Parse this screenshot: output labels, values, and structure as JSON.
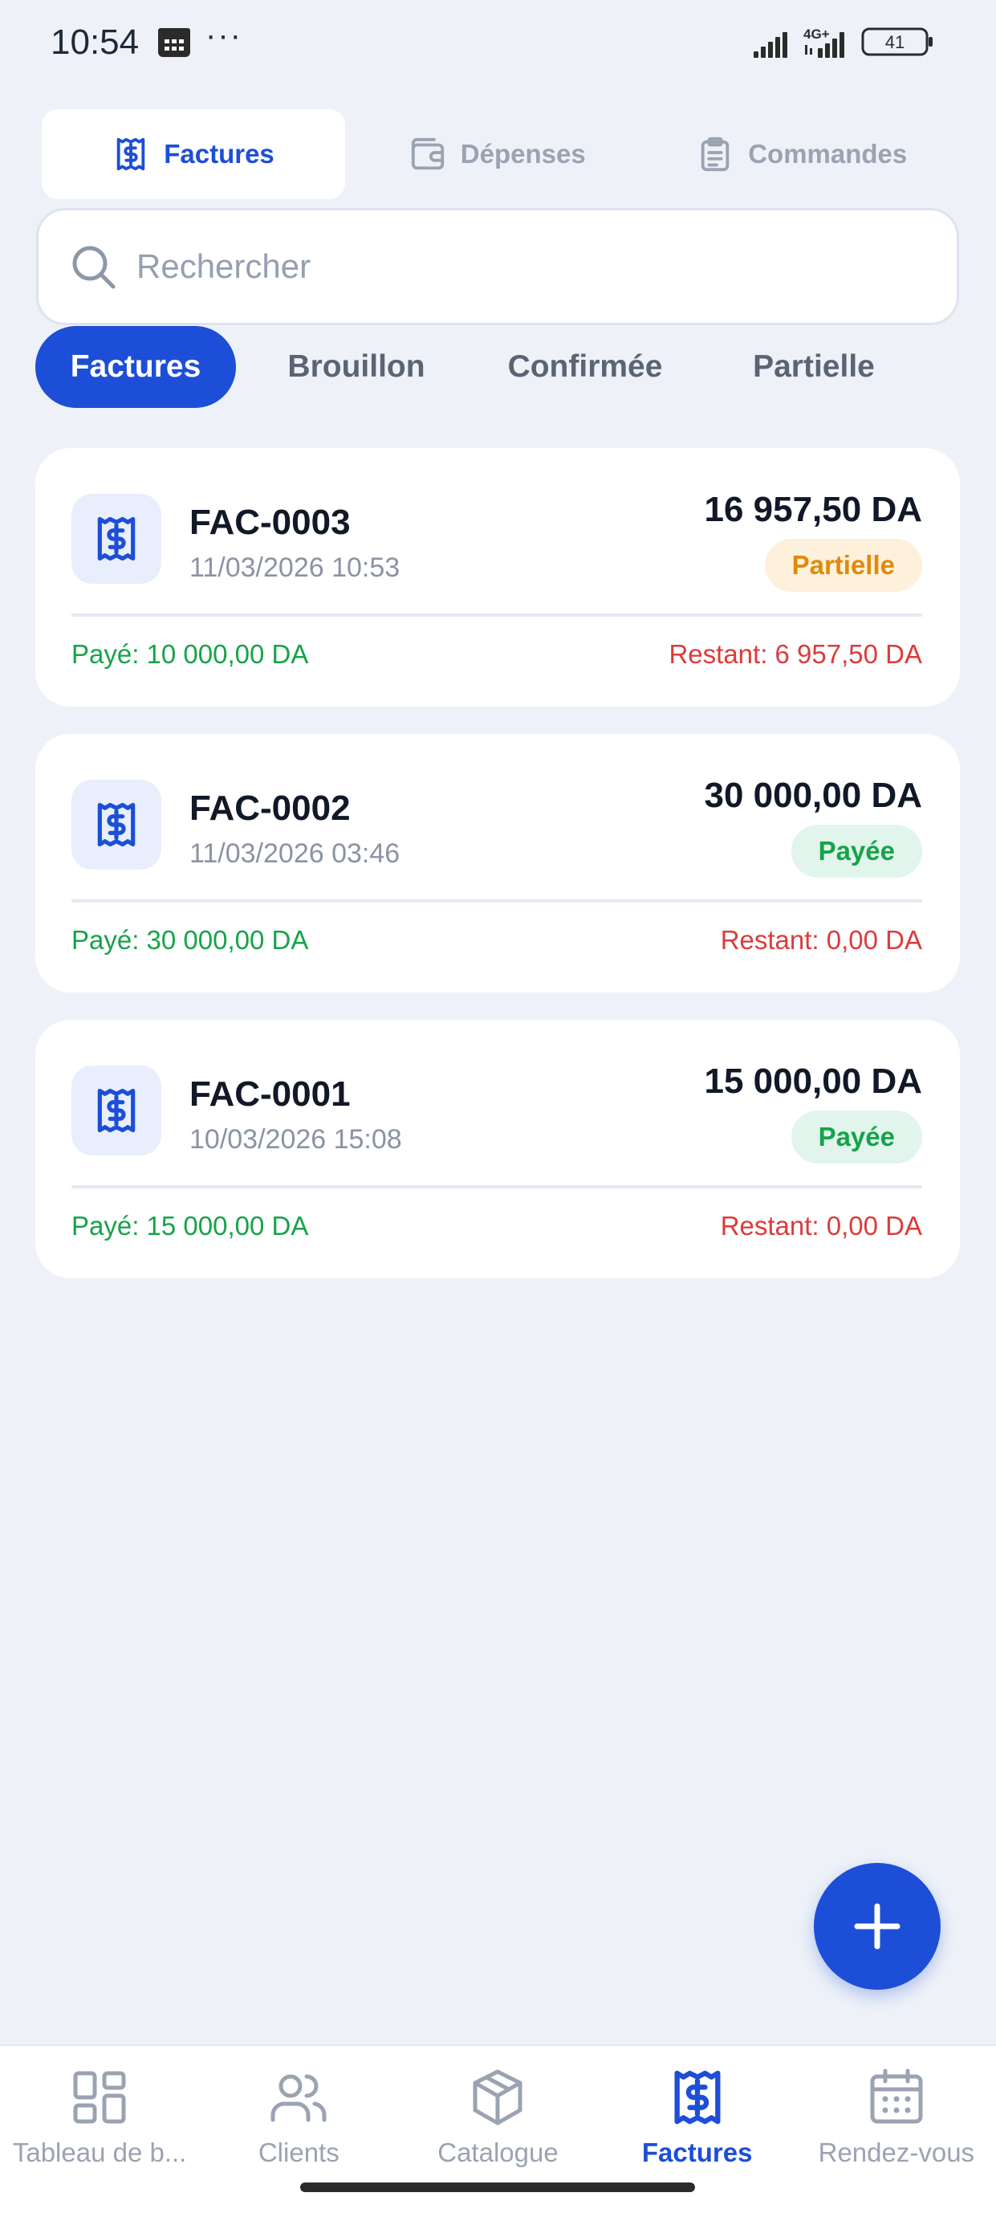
{
  "status": {
    "time": "10:54",
    "dots": "···",
    "network": "4G+",
    "battery": "41"
  },
  "top_tabs": [
    {
      "label": "Factures",
      "icon": "receipt-icon",
      "active": true
    },
    {
      "label": "Dépenses",
      "icon": "wallet-icon",
      "active": false
    },
    {
      "label": "Commandes",
      "icon": "clipboard-icon",
      "active": false
    }
  ],
  "search": {
    "placeholder": "Rechercher",
    "value": ""
  },
  "filters": [
    {
      "label": "Factures",
      "active": true
    },
    {
      "label": "Brouillon",
      "active": false
    },
    {
      "label": "Confirmée",
      "active": false
    },
    {
      "label": "Partielle",
      "active": false
    }
  ],
  "invoices": [
    {
      "number": "FAC-0003",
      "date": "11/03/2026 10:53",
      "amount": "16 957,50 DA",
      "status": "Partielle",
      "paid": "Payé: 10 000,00 DA",
      "remaining": "Restant: 6 957,50 DA"
    },
    {
      "number": "FAC-0002",
      "date": "11/03/2026 03:46",
      "amount": "30 000,00 DA",
      "status": "Payée",
      "paid": "Payé: 30 000,00 DA",
      "remaining": "Restant: 0,00 DA"
    },
    {
      "number": "FAC-0001",
      "date": "10/03/2026 15:08",
      "amount": "15 000,00 DA",
      "status": "Payée",
      "paid": "Payé: 15 000,00 DA",
      "remaining": "Restant: 0,00 DA"
    }
  ],
  "bottom_nav": [
    {
      "label": "Tableau de b...",
      "icon": "dashboard-icon",
      "active": false
    },
    {
      "label": "Clients",
      "icon": "users-icon",
      "active": false
    },
    {
      "label": "Catalogue",
      "icon": "box-icon",
      "active": false
    },
    {
      "label": "Factures",
      "icon": "receipt-icon",
      "active": true
    },
    {
      "label": "Rendez-vous",
      "icon": "calendar-icon",
      "active": false
    }
  ],
  "colors": {
    "accent": "#1d4ed8",
    "background": "#eef2f8",
    "paid": "#16a34a",
    "remaining": "#dc3b3b",
    "partial": "#e08a0b"
  }
}
